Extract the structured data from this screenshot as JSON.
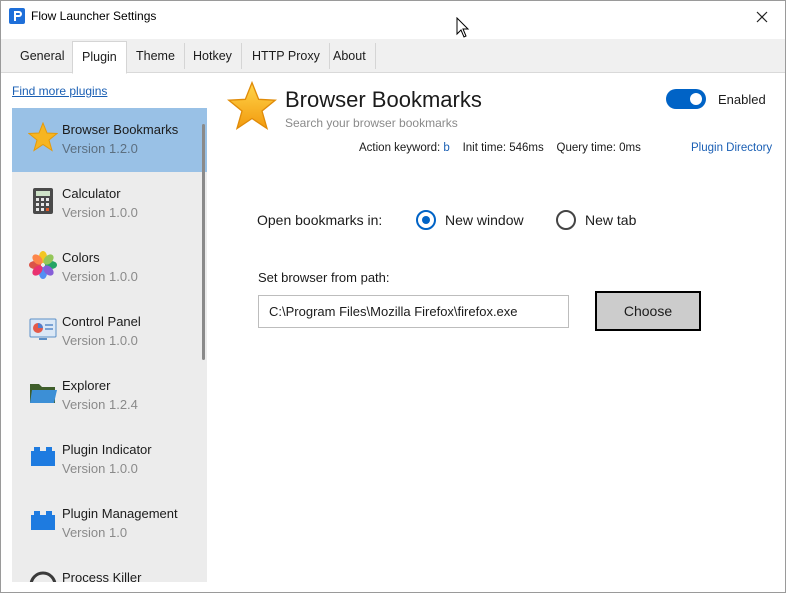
{
  "window": {
    "title": "Flow Launcher Settings"
  },
  "tabs": [
    "General",
    "Plugin",
    "Theme",
    "Hotkey",
    "HTTP Proxy",
    "About"
  ],
  "active_tab": "Plugin",
  "sidebar": {
    "find_more": "Find more plugins",
    "plugins": [
      {
        "name": "Browser Bookmarks",
        "version": "Version 1.2.0",
        "icon": "star-icon",
        "selected": true
      },
      {
        "name": "Calculator",
        "version": "Version 1.0.0",
        "icon": "calculator-icon"
      },
      {
        "name": "Colors",
        "version": "Version 1.0.0",
        "icon": "colors-icon"
      },
      {
        "name": "Control Panel",
        "version": "Version 1.0.0",
        "icon": "control-panel-icon"
      },
      {
        "name": "Explorer",
        "version": "Version 1.2.4",
        "icon": "folder-icon"
      },
      {
        "name": "Plugin Indicator",
        "version": "Version 1.0.0",
        "icon": "lego-block-icon"
      },
      {
        "name": "Plugin Management",
        "version": "Version 1.0",
        "icon": "lego-block-icon"
      },
      {
        "name": "Process Killer",
        "version": "",
        "icon": "process-killer-icon"
      }
    ]
  },
  "detail": {
    "title": "Browser Bookmarks",
    "description": "Search your browser bookmarks",
    "enabled_label": "Enabled",
    "enabled": true,
    "action_keyword_label": "Action keyword:",
    "action_keyword": "b",
    "init_time": "Init time: 546ms",
    "query_time": "Query time: 0ms",
    "plugin_directory": "Plugin Directory"
  },
  "settings": {
    "open_label": "Open bookmarks in:",
    "options": [
      "New window",
      "New tab"
    ],
    "selected_option": "New window",
    "path_label": "Set browser from path:",
    "path_value": "C:\\Program Files\\Mozilla Firefox\\firefox.exe",
    "choose_label": "Choose"
  },
  "colors": {
    "accent": "#0063c6",
    "selected_item": "#99c1e6",
    "sidebar_bg": "#ececec",
    "link": "#1a5fb4"
  }
}
